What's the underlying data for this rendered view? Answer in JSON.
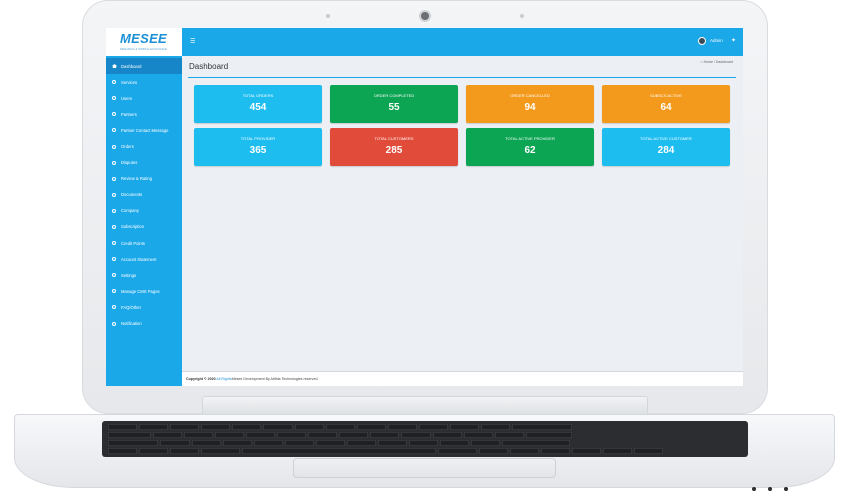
{
  "brand": {
    "logo": "MESEE",
    "tagline": "MEEVEDA & SIMPLE EXCHANGE"
  },
  "header": {
    "menu_icon": "hamburger-icon",
    "user_name": "Admin",
    "share_icon": "share-icon"
  },
  "sidebar": {
    "items": [
      {
        "label": "Dashboard",
        "active": true,
        "icon": "home-icon"
      },
      {
        "label": "Services",
        "active": false,
        "icon": "circle-icon"
      },
      {
        "label": "Users",
        "active": false,
        "icon": "circle-icon"
      },
      {
        "label": "Partners",
        "active": false,
        "icon": "circle-icon"
      },
      {
        "label": "Partner Contact Message",
        "active": false,
        "icon": "circle-icon"
      },
      {
        "label": "Orders",
        "active": false,
        "icon": "circle-icon"
      },
      {
        "label": "Disputes",
        "active": false,
        "icon": "circle-icon"
      },
      {
        "label": "Review & Rating",
        "active": false,
        "icon": "circle-icon"
      },
      {
        "label": "Documents",
        "active": false,
        "icon": "circle-icon"
      },
      {
        "label": "Company",
        "active": false,
        "icon": "circle-icon"
      },
      {
        "label": "Subscription",
        "active": false,
        "icon": "circle-icon"
      },
      {
        "label": "Credit Points",
        "active": false,
        "icon": "circle-icon"
      },
      {
        "label": "Account Statement",
        "active": false,
        "icon": "circle-icon"
      },
      {
        "label": "Settings",
        "active": false,
        "icon": "circle-icon"
      },
      {
        "label": "Manage CMS Pages",
        "active": false,
        "icon": "circle-icon"
      },
      {
        "label": "FAQ/Other",
        "active": false,
        "icon": "circle-icon"
      },
      {
        "label": "Notification",
        "active": false,
        "icon": "circle-icon"
      }
    ]
  },
  "main": {
    "title": "Dashboard",
    "breadcrumb": {
      "home": "Home",
      "separator": "/",
      "current": "Dashboard"
    },
    "cards": [
      {
        "label": "TOTAL ORDERS",
        "value": "454",
        "color": "#1ebdf0"
      },
      {
        "label": "ORDER COMPLETED",
        "value": "55",
        "color": "#0ca553"
      },
      {
        "label": "ORDER CANCELLED",
        "value": "94",
        "color": "#f39a1c"
      },
      {
        "label": "SUBSCS ACTIVE",
        "value": "64",
        "color": "#f39a1c"
      },
      {
        "label": "TOTAL PROVIDER",
        "value": "365",
        "color": "#1ebdf0"
      },
      {
        "label": "TOTAL CUSTOMERS",
        "value": "285",
        "color": "#e04b3a"
      },
      {
        "label": "TOTAL ACTIVE PROVIDER",
        "value": "62",
        "color": "#0ca553"
      },
      {
        "label": "TOTAL ACTIVE CUSTOMER",
        "value": "284",
        "color": "#1ebdf0"
      }
    ]
  },
  "footer": {
    "copyright": "Copyright © 2020",
    "rights": "All Rights",
    "rest": "Mesee Development By Atithia Technologies reserved."
  },
  "colors": {
    "primary": "#1ba8e8",
    "sidebar_active": "#1686c8",
    "background": "#ecf0f5"
  }
}
